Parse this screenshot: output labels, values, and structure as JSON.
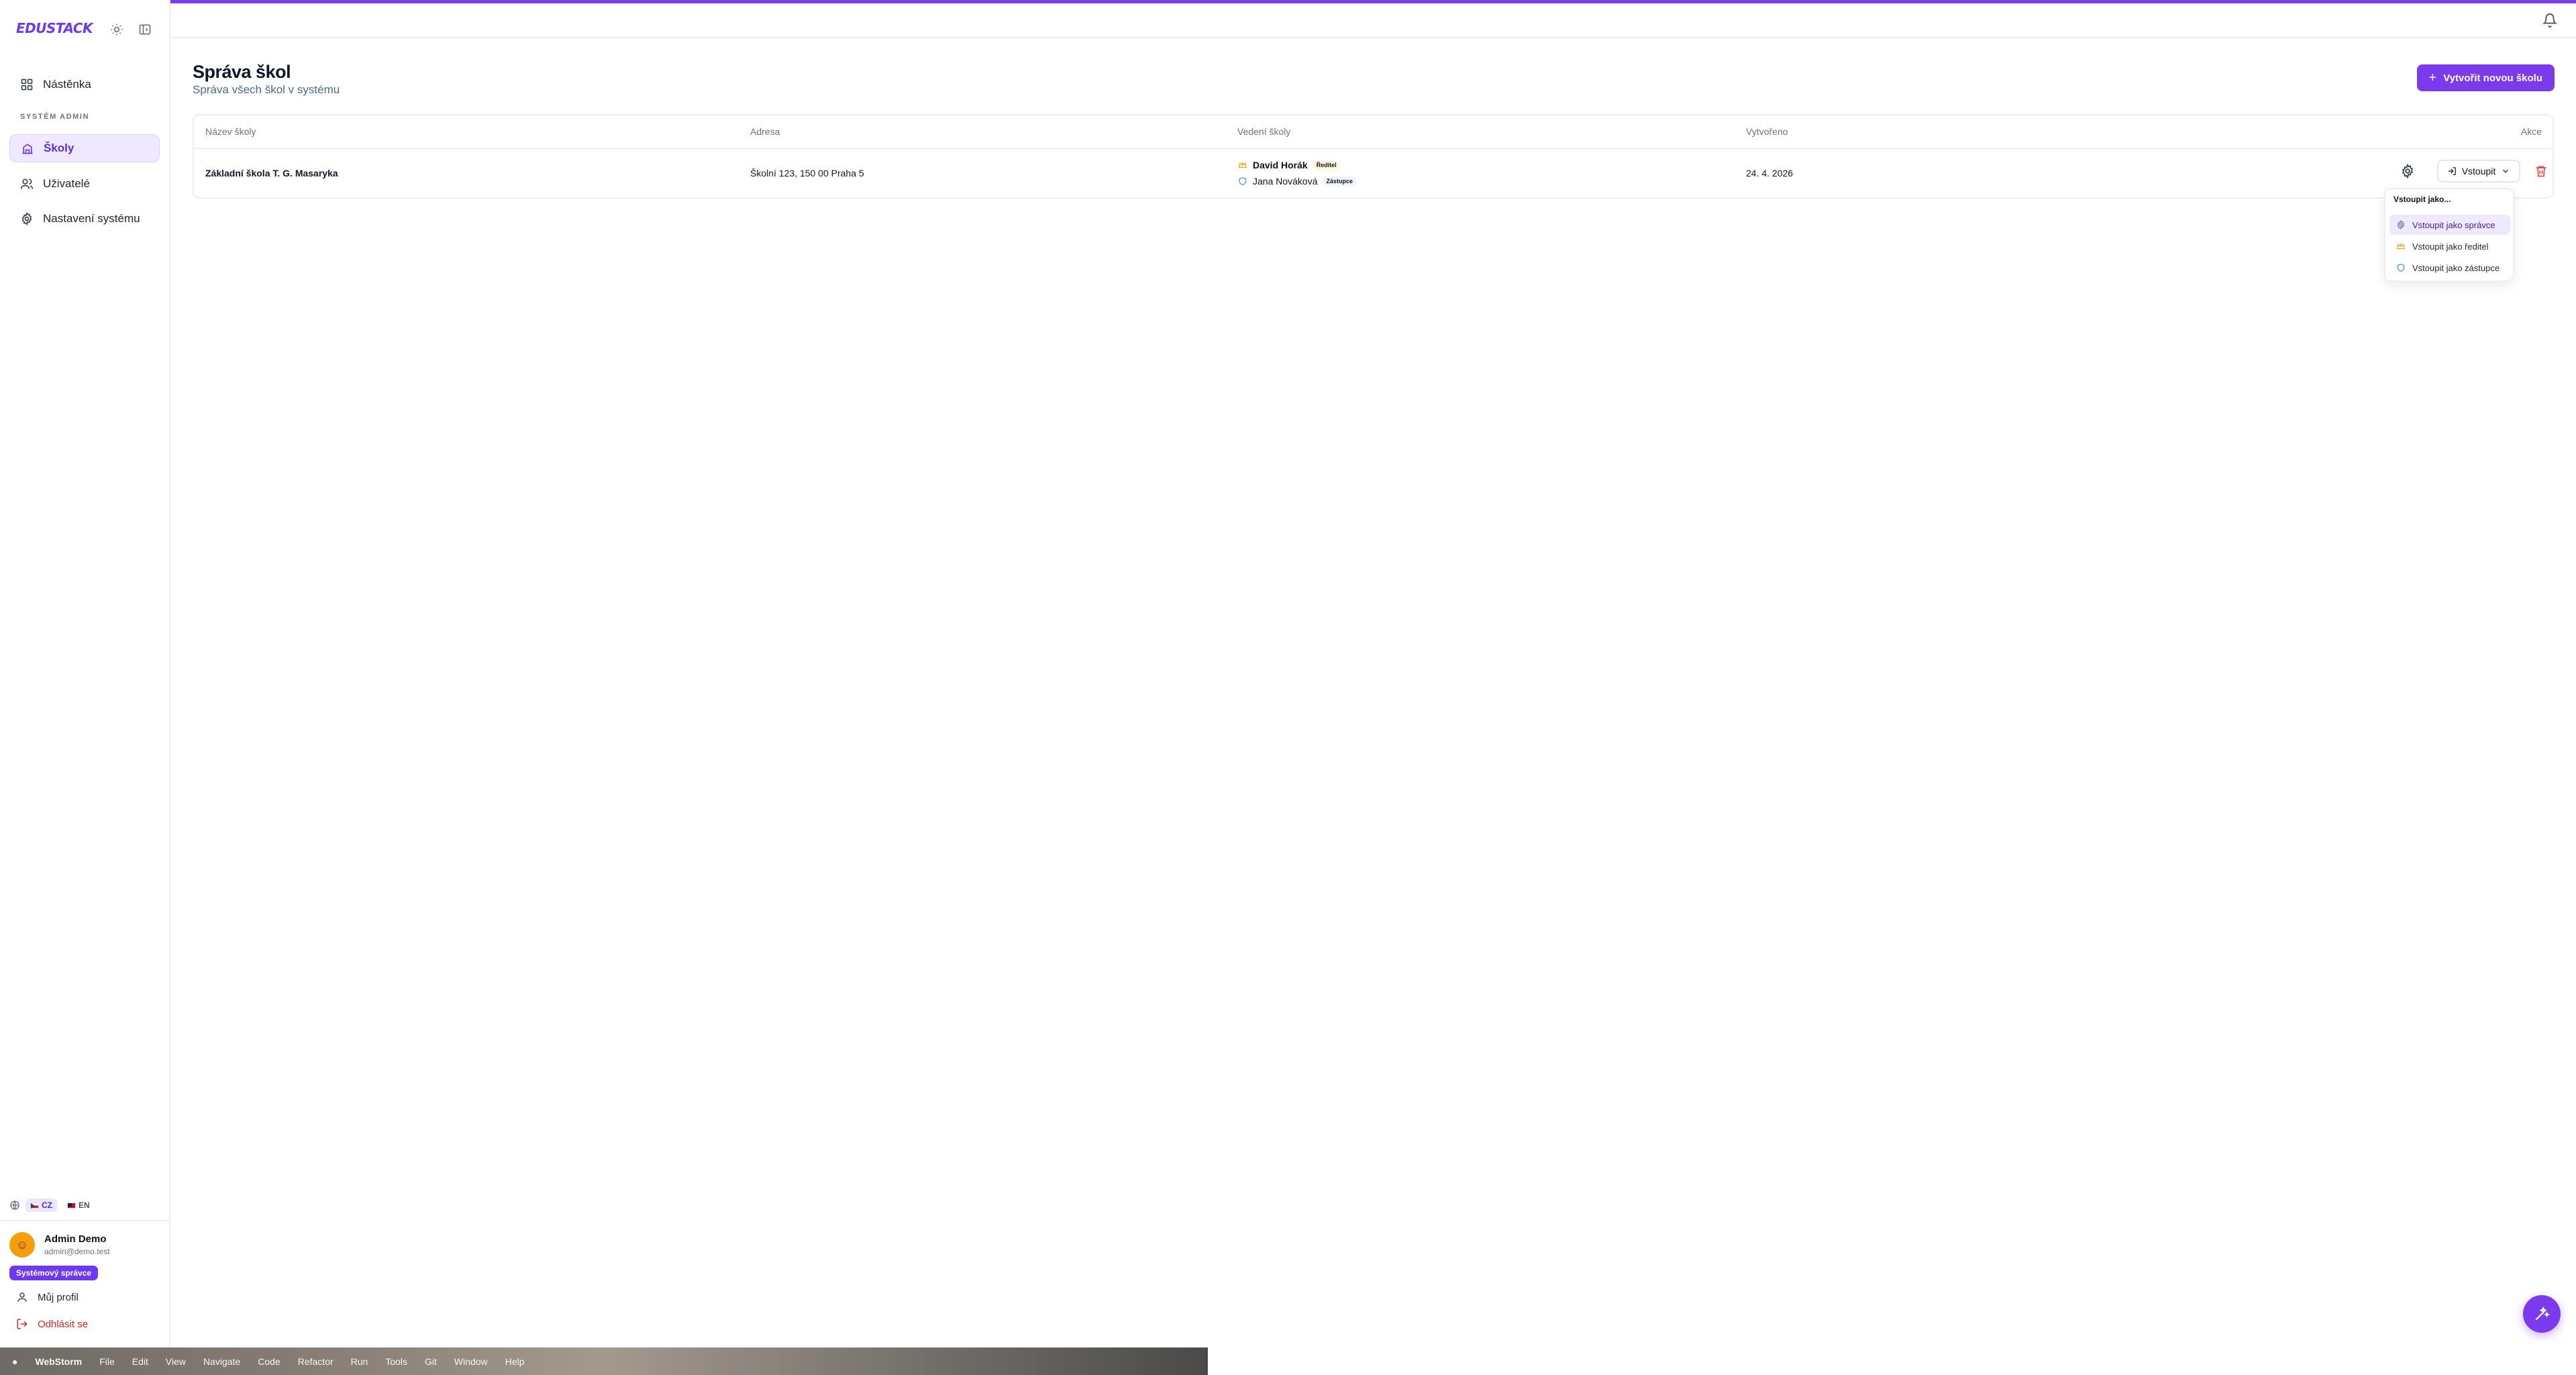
{
  "brand": "EDUSTACK",
  "sidebar": {
    "dashboard": "Nástěnka",
    "section": "SYSTÉM ADMIN",
    "items": [
      {
        "label": "Školy"
      },
      {
        "label": "Uživatelé"
      },
      {
        "label": "Nastavení systému"
      }
    ]
  },
  "language": {
    "cz": "CZ",
    "en": "EN"
  },
  "user": {
    "name": "Admin Demo",
    "email": "admin@demo.test",
    "role": "Systémový správce",
    "profile": "Můj profil",
    "logout": "Odhlásit se"
  },
  "page": {
    "title": "Správa škol",
    "subtitle": "Správa všech škol v systému",
    "create_button": "Vytvořit novou školu"
  },
  "table": {
    "columns": [
      "Název školy",
      "Adresa",
      "Vedení školy",
      "Vytvořeno",
      "Akce"
    ],
    "rows": [
      {
        "name": "Základní škola T. G. Masaryka",
        "address": "Školní 123, 150 00 Praha 5",
        "leaders": [
          {
            "name": "David Horák",
            "role": "Ředitel"
          },
          {
            "name": "Jana Nováková",
            "role": "Zástupce"
          }
        ],
        "created": "24. 4. 2026",
        "enter_label": "Vstoupit"
      }
    ]
  },
  "dropdown": {
    "title": "Vstoupit jako...",
    "items": [
      "Vstoupit jako správce",
      "Vstoupit jako ředitel",
      "Vstoupit jako zástupce"
    ]
  },
  "os_menu": {
    "items": [
      "WebStorm",
      "File",
      "Edit",
      "View",
      "Navigate",
      "Code",
      "Refactor",
      "Run",
      "Tools",
      "Git",
      "Window",
      "Help"
    ]
  },
  "colors": {
    "accent": "#7c3aed",
    "danger": "#dc2626"
  }
}
